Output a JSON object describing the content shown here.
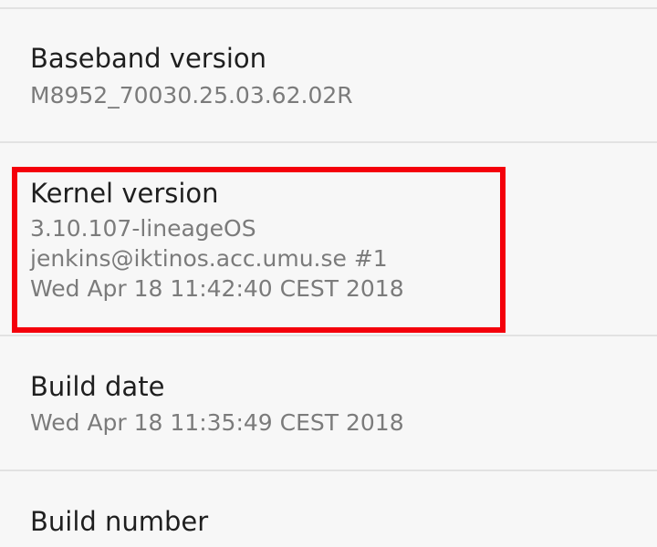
{
  "settings_list": {
    "baseband": {
      "title": "Baseband version",
      "summary": "M8952_70030.25.03.62.02R"
    },
    "kernel": {
      "title": "Kernel version",
      "summary_lines": [
        "3.10.107-lineageOS",
        "jenkins@iktinos.acc.umu.se #1",
        "Wed Apr 18 11:42:40 CEST 2018"
      ]
    },
    "build_date": {
      "title": "Build date",
      "summary": "Wed Apr 18 11:35:49 CEST 2018"
    },
    "build_number": {
      "title": "Build number"
    }
  },
  "annotation": {
    "highlight_color": "#f4000b"
  },
  "colors": {
    "background": "#f7f7f7",
    "title_text": "#1f1f1f",
    "summary_text": "#7b7b7b",
    "divider": "#e2e2e2"
  }
}
